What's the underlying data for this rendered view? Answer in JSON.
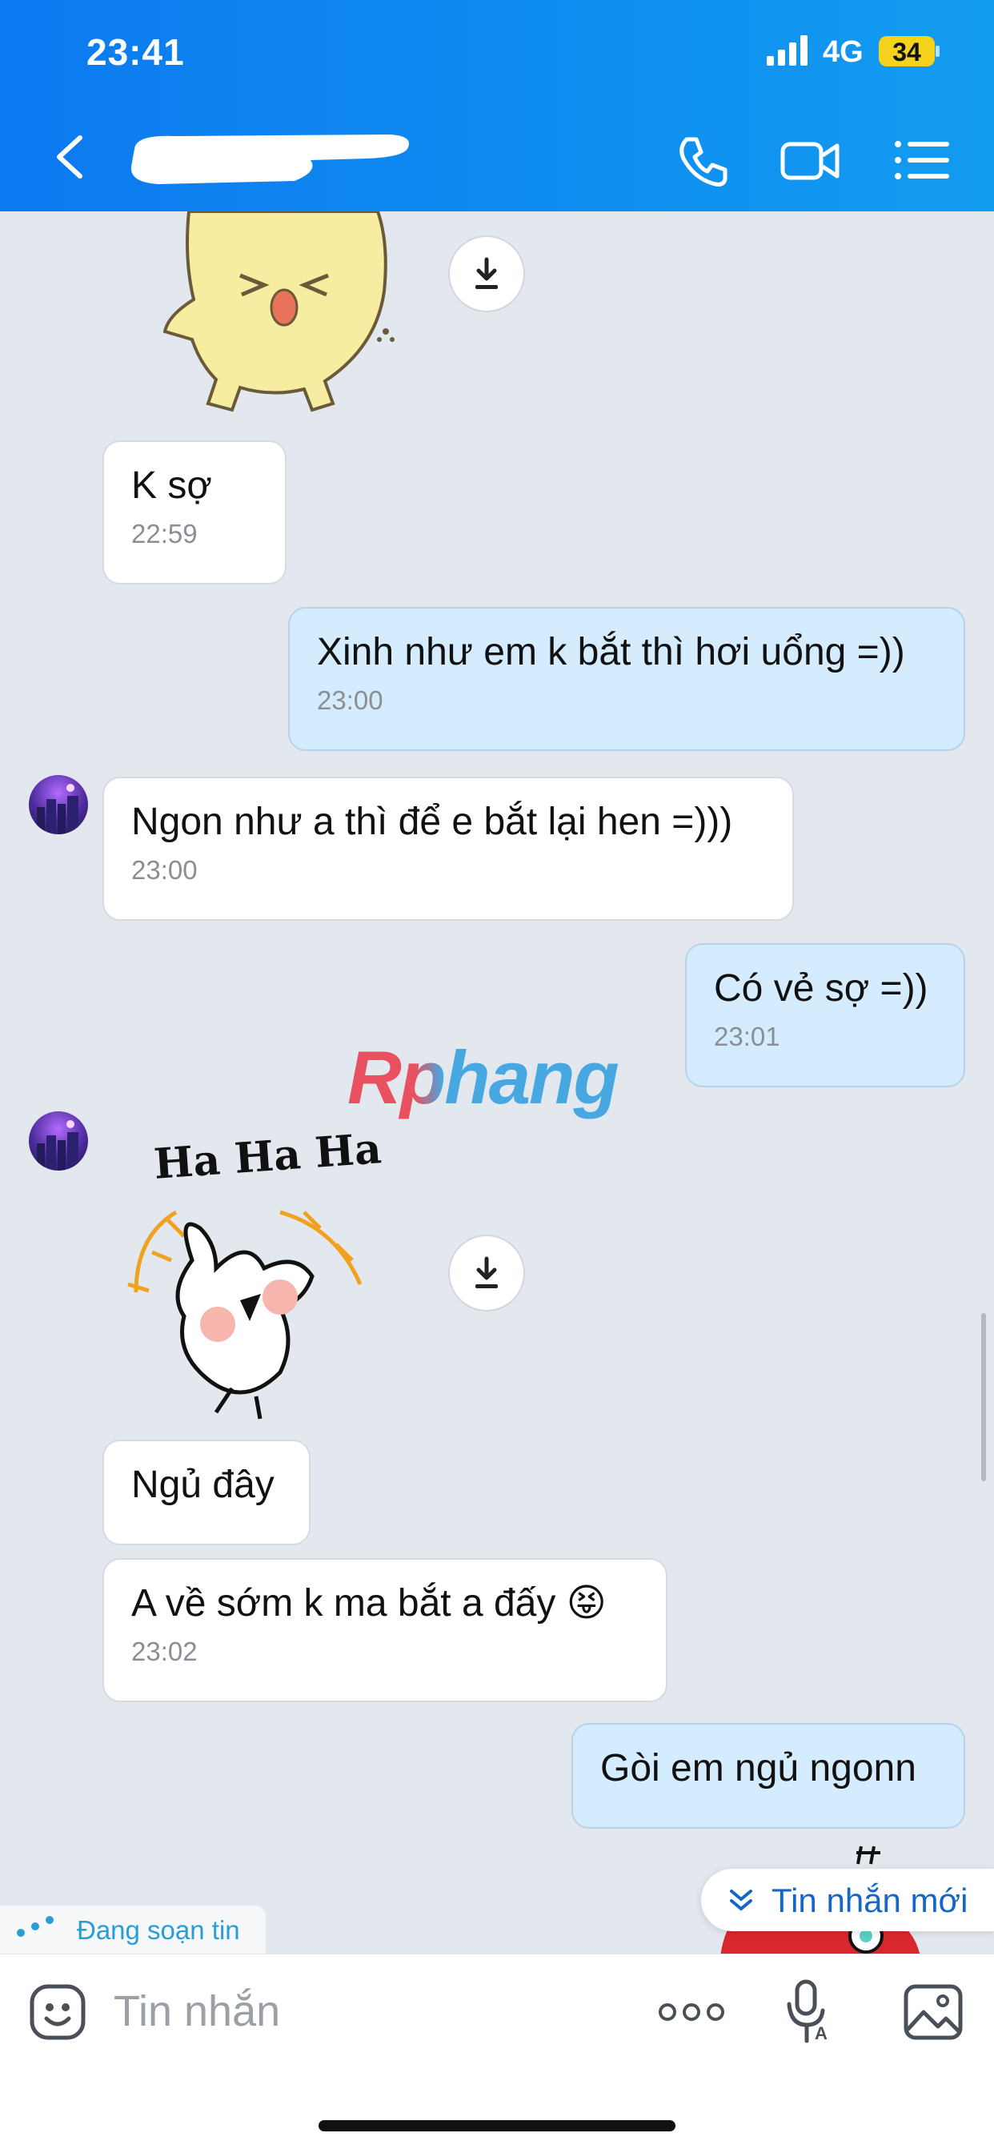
{
  "status_bar": {
    "time": "23:41",
    "network": "4G",
    "battery": "34"
  },
  "header": {
    "back_icon": "chevron-left-icon",
    "call_icon": "phone-icon",
    "video_icon": "video-camera-icon",
    "menu_icon": "list-menu-icon"
  },
  "messages": [
    {
      "type": "sticker",
      "from": "in",
      "name": "yellow-chick-sticker"
    },
    {
      "type": "text",
      "from": "in",
      "text": "K sợ",
      "time": "22:59"
    },
    {
      "type": "text",
      "from": "out",
      "text": "Xinh như em k bắt thì hơi uổng =))",
      "time": "23:00"
    },
    {
      "type": "text",
      "from": "in",
      "text": "Ngon như a thì để e bắt lại hen =)))",
      "time": "23:00"
    },
    {
      "type": "text",
      "from": "out",
      "text": "Có vẻ sợ =))",
      "time": "23:01"
    },
    {
      "type": "sticker",
      "from": "in",
      "name": "haha-rabbit-sticker",
      "caption": "Ha Ha Ha"
    },
    {
      "type": "text",
      "from": "in",
      "text": "Ngủ đây"
    },
    {
      "type": "text",
      "from": "in",
      "text": "A về sớm k ma bắt a đấy 😝",
      "time": "23:02"
    },
    {
      "type": "text",
      "from": "out",
      "text": "Gòi em ngủ ngonn"
    }
  ],
  "watermark": "Rphang",
  "typing_indicator": "Đang soạn tin",
  "new_messages_button": "Tin nhắn mới",
  "input": {
    "placeholder": "Tin nhắn",
    "emoji_icon": "emoji-icon",
    "more_icon": "more-dots-icon",
    "voice_icon": "voice-to-text-icon",
    "image_icon": "image-icon"
  },
  "colors": {
    "header": "#0c79f0",
    "outgoing_bubble": "#d4ecfd",
    "incoming_bubble": "#ffffff",
    "accent": "#1466c8"
  }
}
